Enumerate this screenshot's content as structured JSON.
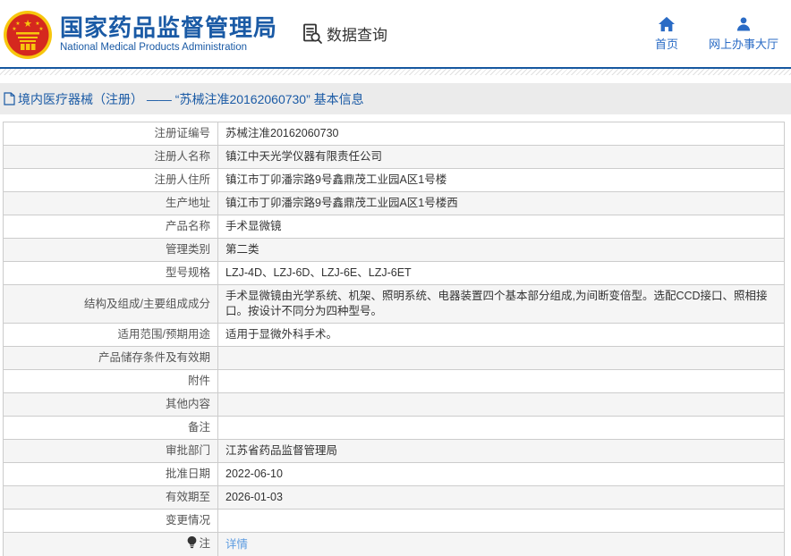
{
  "header": {
    "title": "国家药品监督管理局",
    "subtitle": "National Medical Products Administration",
    "data_query_label": "数据查询",
    "nav": [
      {
        "label": "首页",
        "icon": "home-icon"
      },
      {
        "label": "网上办事大厅",
        "icon": "person-icon"
      }
    ]
  },
  "breadcrumb": {
    "text": "境内医疗器械（注册） —— “苏械注准20162060730” 基本信息"
  },
  "table": {
    "rows": [
      {
        "label": "注册证编号",
        "value": "苏械注准20162060730"
      },
      {
        "label": "注册人名称",
        "value": "镇江中天光学仪器有限责任公司"
      },
      {
        "label": "注册人住所",
        "value": "镇江市丁卯潘宗路9号鑫鼎茂工业园A区1号楼"
      },
      {
        "label": "生产地址",
        "value": "镇江市丁卯潘宗路9号鑫鼎茂工业园A区1号楼西"
      },
      {
        "label": "产品名称",
        "value": "手术显微镜"
      },
      {
        "label": "管理类别",
        "value": "第二类"
      },
      {
        "label": "型号规格",
        "value": "LZJ-4D、LZJ-6D、LZJ-6E、LZJ-6ET"
      },
      {
        "label": "结构及组成/主要组成成分",
        "value": "手术显微镜由光学系统、机架、照明系统、电器装置四个基本部分组成,为间断变倍型。选配CCD接口、照相接口。按设计不同分为四种型号。"
      },
      {
        "label": "适用范围/预期用途",
        "value": "适用于显微外科手术。"
      },
      {
        "label": "产品储存条件及有效期",
        "value": ""
      },
      {
        "label": "附件",
        "value": ""
      },
      {
        "label": "其他内容",
        "value": ""
      },
      {
        "label": "备注",
        "value": ""
      },
      {
        "label": "审批部门",
        "value": "江苏省药品监督管理局"
      },
      {
        "label": "批准日期",
        "value": "2022-06-10"
      },
      {
        "label": "有效期至",
        "value": "2026-01-03"
      },
      {
        "label": "变更情况",
        "value": ""
      },
      {
        "label": "注",
        "label_icon": "bulb-icon",
        "value": "详情",
        "value_is_link": true
      }
    ]
  },
  "colors": {
    "brand_blue": "#1a5aa5",
    "nav_blue": "#2a6bc5",
    "link_blue": "#5b9be0",
    "emblem_red": "#d5281e",
    "emblem_gold": "#f7c60d",
    "table_border": "#cccccc",
    "alt_row_bg": "#f5f5f5",
    "breadcrumb_bg": "#ebebeb"
  }
}
